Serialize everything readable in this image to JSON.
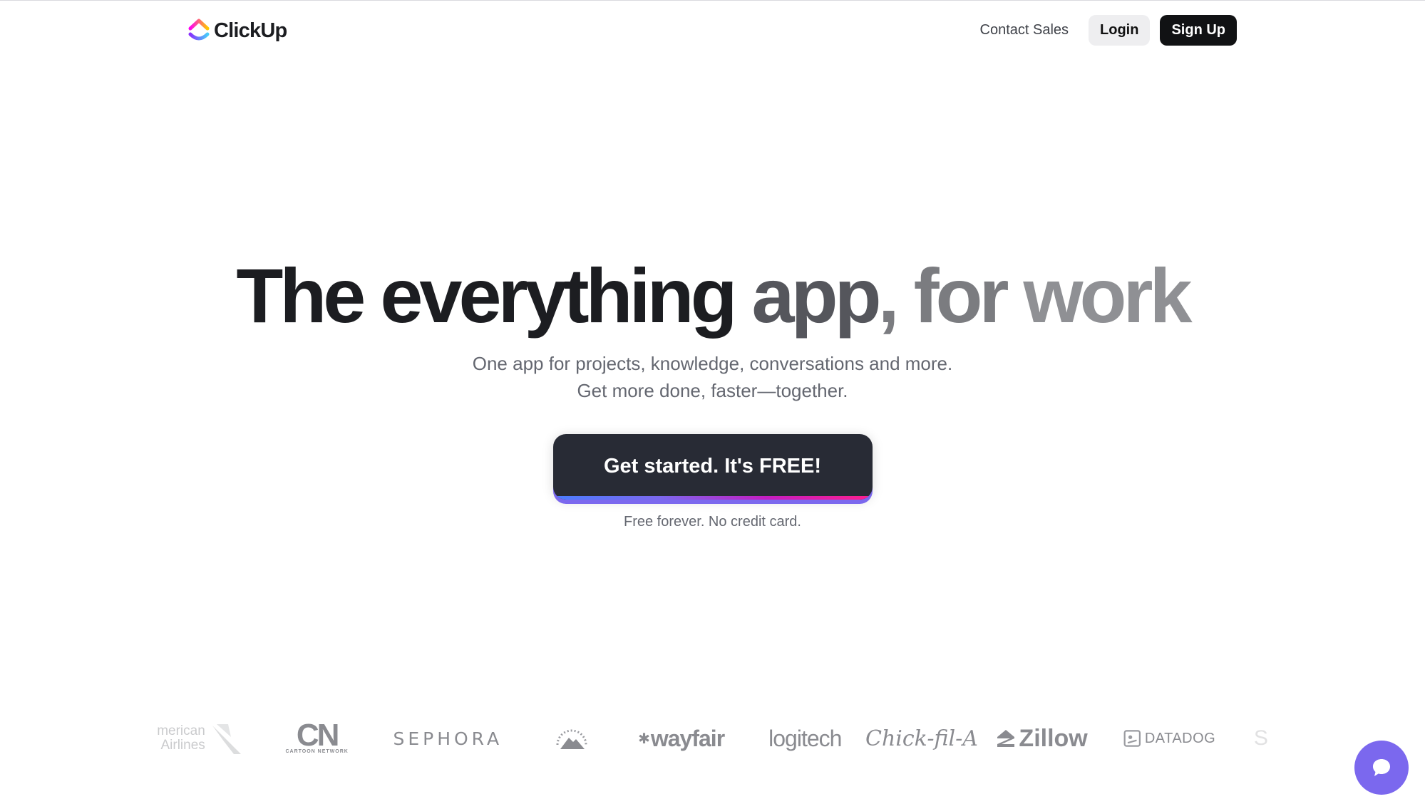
{
  "header": {
    "logo_text": "ClickUp",
    "contact_sales": "Contact Sales",
    "login": "Login",
    "sign_up": "Sign Up"
  },
  "hero": {
    "headline_dark": "The everything",
    "headline_mid": " app",
    "headline_gray": ", for",
    "headline_light": " work",
    "subtitle_line1": "One app for projects, knowledge, conversations and more.",
    "subtitle_line2": "Get more done, faster—together.",
    "cta_label": "Get started. It's FREE!",
    "cta_note": "Free forever. No credit card."
  },
  "logos": {
    "american_airlines": [
      "merican",
      "Airlines"
    ],
    "cartoon_network": "CN",
    "cartoon_network_sub": "CARTOON NETWORK",
    "sephora": "SEPHORA",
    "wayfair": "wayfair",
    "logitech": "logitech",
    "chick_fil_a": "Chick-fil-A",
    "zillow": "Zillow",
    "datadog": "DATADOG",
    "partial": "S"
  },
  "colors": {
    "accent": "#7b68ee",
    "cta_bg": "#282b35",
    "text_dark": "#1c1d21"
  }
}
